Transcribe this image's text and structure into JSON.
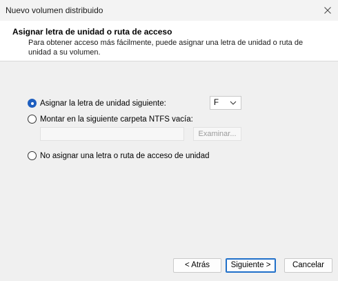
{
  "window": {
    "title": "Nuevo volumen distribuido"
  },
  "header": {
    "title": "Asignar letra de unidad o ruta de acceso",
    "description": "Para obtener acceso más fácilmente, puede asignar una letra de unidad o ruta de unidad a su volumen."
  },
  "options": {
    "assign_letter": {
      "label": "Asignar la letra de unidad siguiente:",
      "selected": true
    },
    "mount_folder": {
      "label": "Montar en la siguiente carpeta NTFS vacía:",
      "selected": false
    },
    "no_assign": {
      "label": "No asignar una letra o ruta de acceso de unidad",
      "selected": false
    }
  },
  "drive_letter": {
    "value": "F"
  },
  "folder_path": {
    "value": ""
  },
  "browse_button": {
    "label": "Examinar..."
  },
  "footer": {
    "back_label": "< Atrás",
    "next_label": "Siguiente >",
    "cancel_label": "Cancelar"
  },
  "colors": {
    "accent": "#1f5fbf",
    "header_bg": "#ffffff",
    "dialog_bg": "#f0f0f0"
  },
  "icons": {
    "close": "close-icon",
    "dropdown": "chevron-down-icon"
  }
}
